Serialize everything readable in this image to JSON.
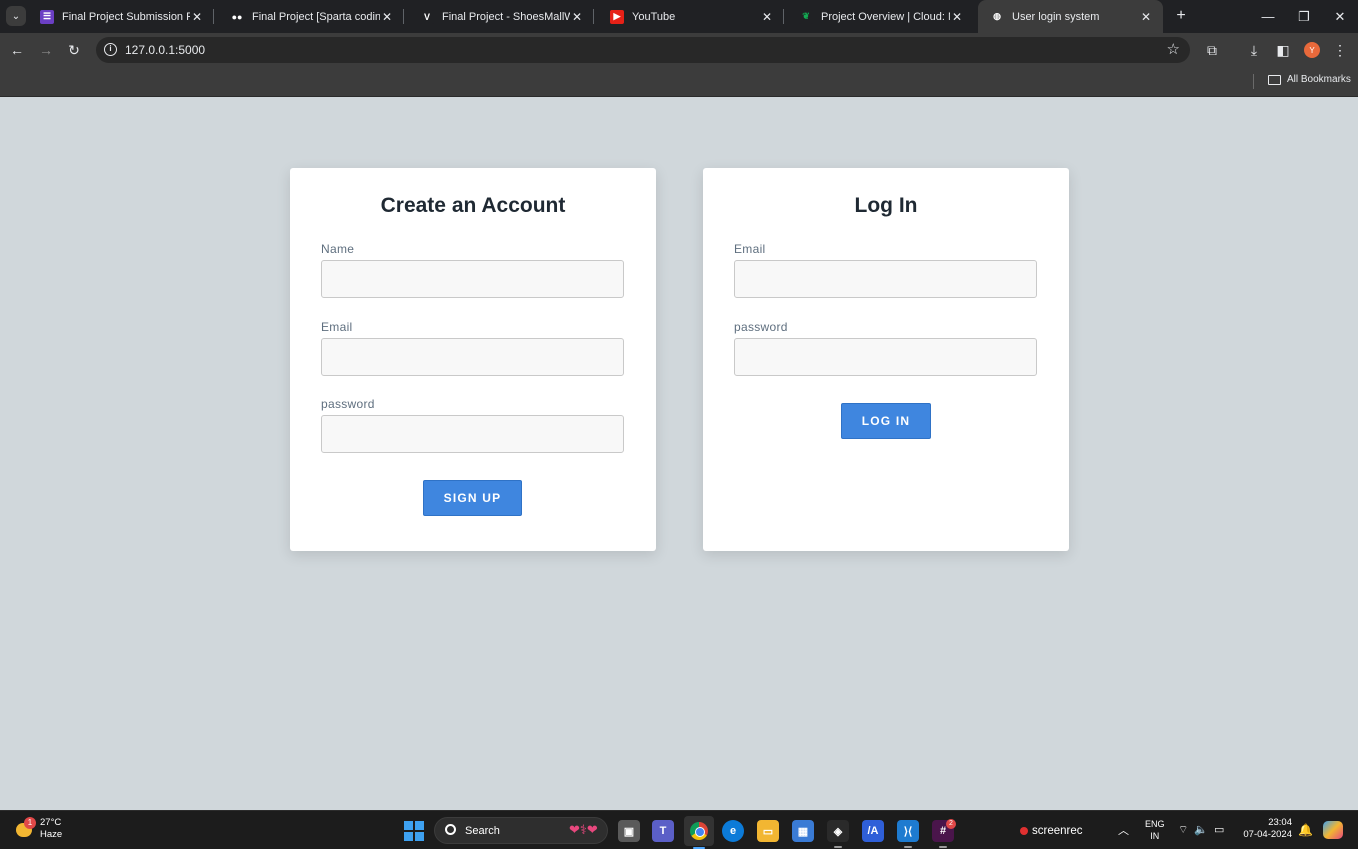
{
  "browser": {
    "tabs": [
      {
        "title": "Final Project Submission Form",
        "favicon": "form-icon",
        "color": "#6b3fc4",
        "glyph": "☰"
      },
      {
        "title": "Final Project [Sparta coding club",
        "favicon": "medium-icon",
        "color": "#202124",
        "glyph": "●●"
      },
      {
        "title": "Final Project - ShoesMallWebsite",
        "favicon": "vercel-v-icon",
        "color": "#202124",
        "glyph": "V"
      },
      {
        "title": "YouTube",
        "favicon": "youtube-icon",
        "color": "#e62117",
        "glyph": "▶"
      },
      {
        "title": "Project Overview | Cloud: MongoDB",
        "favicon": "mongodb-leaf-icon",
        "color": "#202124",
        "glyph": "❦"
      },
      {
        "title": "User login system",
        "favicon": "globe-icon",
        "color": "#3c3c3c",
        "glyph": "◍",
        "active": true
      }
    ],
    "url": "127.0.0.1:5000",
    "profile_initial": "Y",
    "bookmarks_label": "All Bookmarks"
  },
  "signup": {
    "title": "Create an Account",
    "name_label": "Name",
    "email_label": "Email",
    "password_label": "password",
    "button": "SIGN UP"
  },
  "login": {
    "title": "Log In",
    "email_label": "Email",
    "password_label": "password",
    "button": "LOG IN"
  },
  "taskbar": {
    "weather_temp": "27°C",
    "weather_desc": "Haze",
    "weather_badge": "1",
    "search_label": "Search",
    "slack_badge": "2",
    "screenrec": "screenrec",
    "lang_top": "ENG",
    "lang_bottom": "IN",
    "time": "23:04",
    "date": "07-04-2024"
  },
  "colors": {
    "page_bg": "#d0d7db",
    "button_blue": "#3f86df",
    "tab_strip": "#202124"
  }
}
